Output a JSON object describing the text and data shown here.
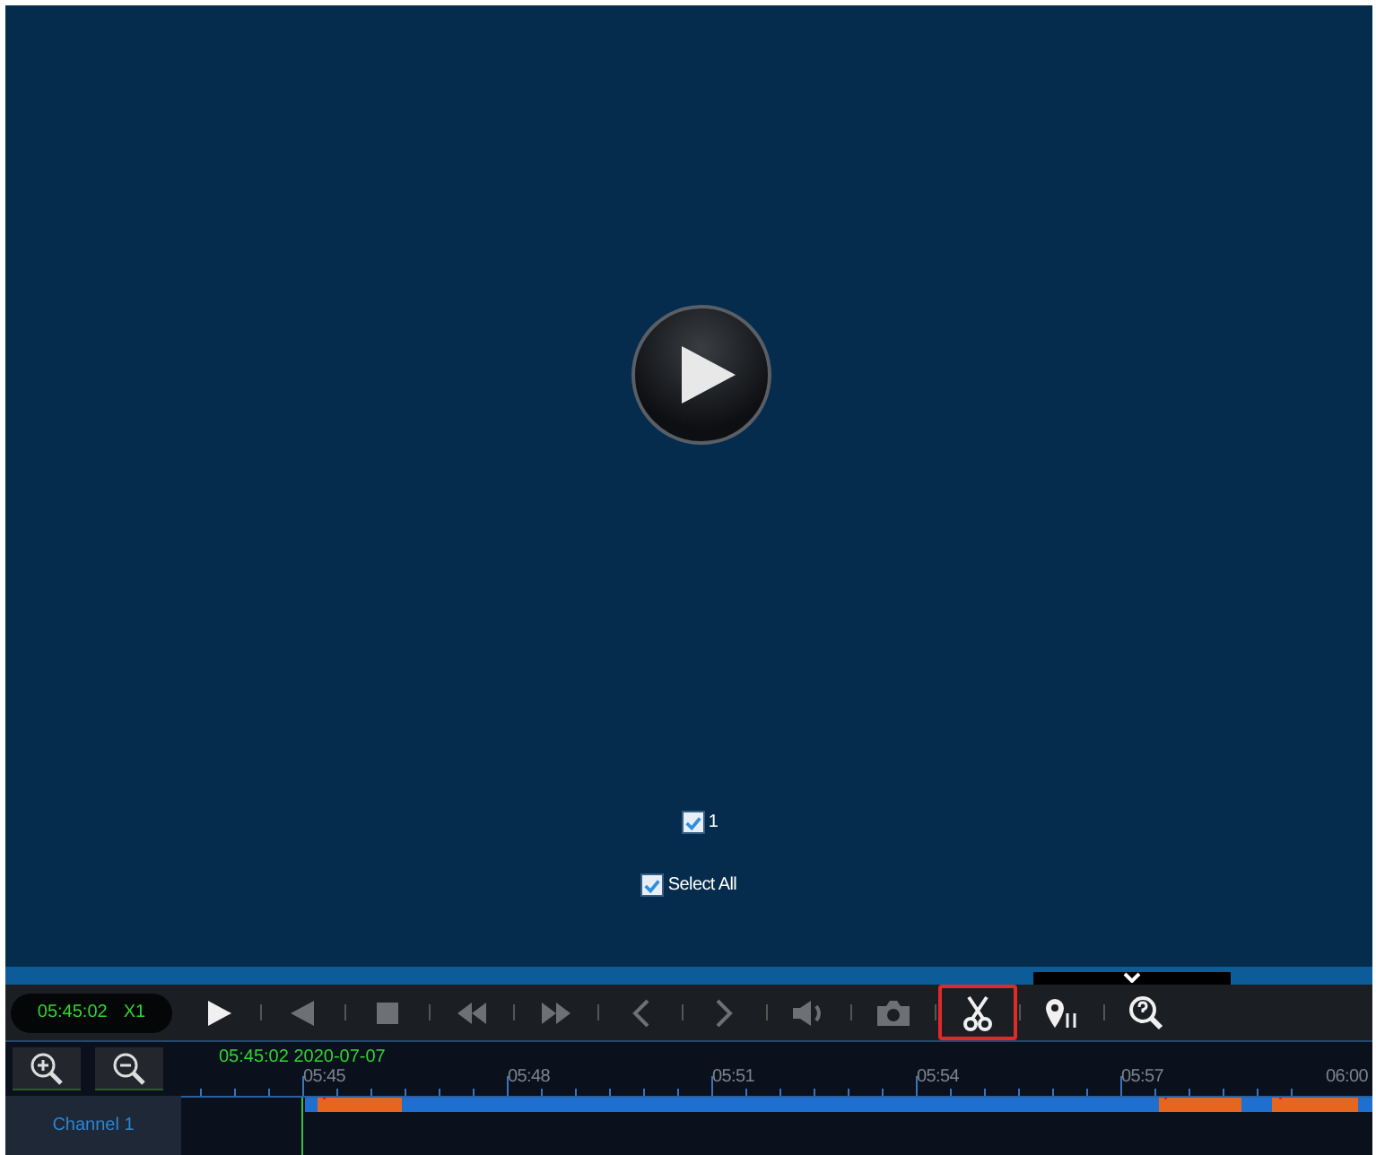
{
  "video": {
    "selections": [
      {
        "label": "1",
        "checked": true
      },
      {
        "label": "Select All",
        "checked": true
      }
    ]
  },
  "toolbar": {
    "time": "05:45:02",
    "speed": "X1",
    "buttons": [
      {
        "kind": "play",
        "disabled": false,
        "selected": false
      },
      {
        "kind": "reverse",
        "disabled": true,
        "selected": false
      },
      {
        "kind": "stop",
        "disabled": true,
        "selected": false
      },
      {
        "kind": "rewind",
        "disabled": true,
        "selected": false
      },
      {
        "kind": "forward",
        "disabled": true,
        "selected": false
      },
      {
        "kind": "prev",
        "disabled": true,
        "selected": false
      },
      {
        "kind": "next",
        "disabled": true,
        "selected": false
      },
      {
        "kind": "sound",
        "disabled": true,
        "selected": false
      },
      {
        "kind": "snapshot",
        "disabled": true,
        "selected": false
      },
      {
        "kind": "clip",
        "disabled": false,
        "selected": true
      },
      {
        "kind": "pin",
        "disabled": false,
        "selected": false
      },
      {
        "kind": "search",
        "disabled": false,
        "selected": false
      }
    ]
  },
  "timeline": {
    "current": "05:45:02 2020-07-07",
    "ticks": [
      "05:45",
      "05:48",
      "05:51",
      "05:54",
      "05:57",
      "06:00"
    ],
    "channels": [
      {
        "label": "Channel 1"
      }
    ]
  }
}
